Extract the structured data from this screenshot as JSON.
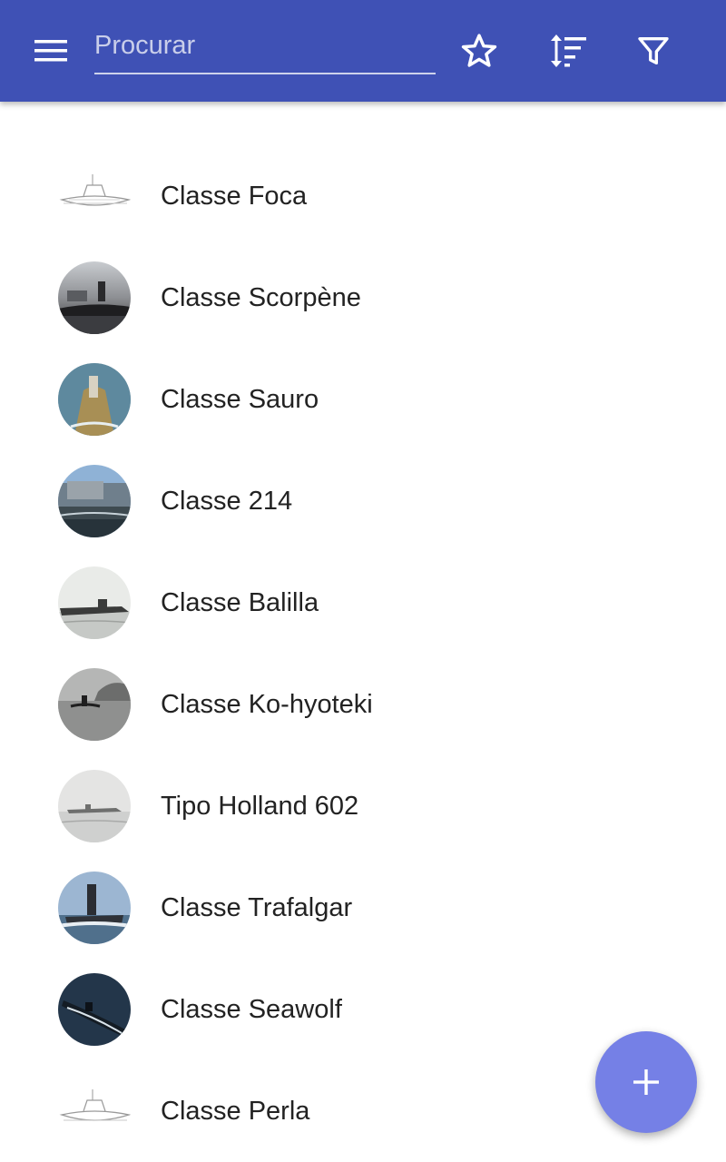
{
  "toolbar": {
    "search_placeholder": "Procurar",
    "background_color": "#3f51b5"
  },
  "icons": {
    "menu": "menu-icon",
    "favorites": "star-outline-icon",
    "sort": "sort-icon",
    "filter": "filter-icon",
    "add": "plus-icon"
  },
  "items": [
    {
      "label": "Classe Foca",
      "thumb": "line-drawing"
    },
    {
      "label": "Classe Scorpène",
      "thumb": "harbor-photo"
    },
    {
      "label": "Classe Sauro",
      "thumb": "sea-aerial-photo"
    },
    {
      "label": "Classe 214",
      "thumb": "dock-photo"
    },
    {
      "label": "Classe Balilla",
      "thumb": "bw-photo"
    },
    {
      "label": "Classe Ko-hyoteki",
      "thumb": "bw-photo"
    },
    {
      "label": "Tipo Holland 602",
      "thumb": "bw-photo"
    },
    {
      "label": "Classe Trafalgar",
      "thumb": "sea-photo"
    },
    {
      "label": "Classe Seawolf",
      "thumb": "dark-sea-photo"
    },
    {
      "label": "Classe Perla",
      "thumb": "line-drawing"
    }
  ],
  "fab": {
    "color": "#7580e6"
  }
}
